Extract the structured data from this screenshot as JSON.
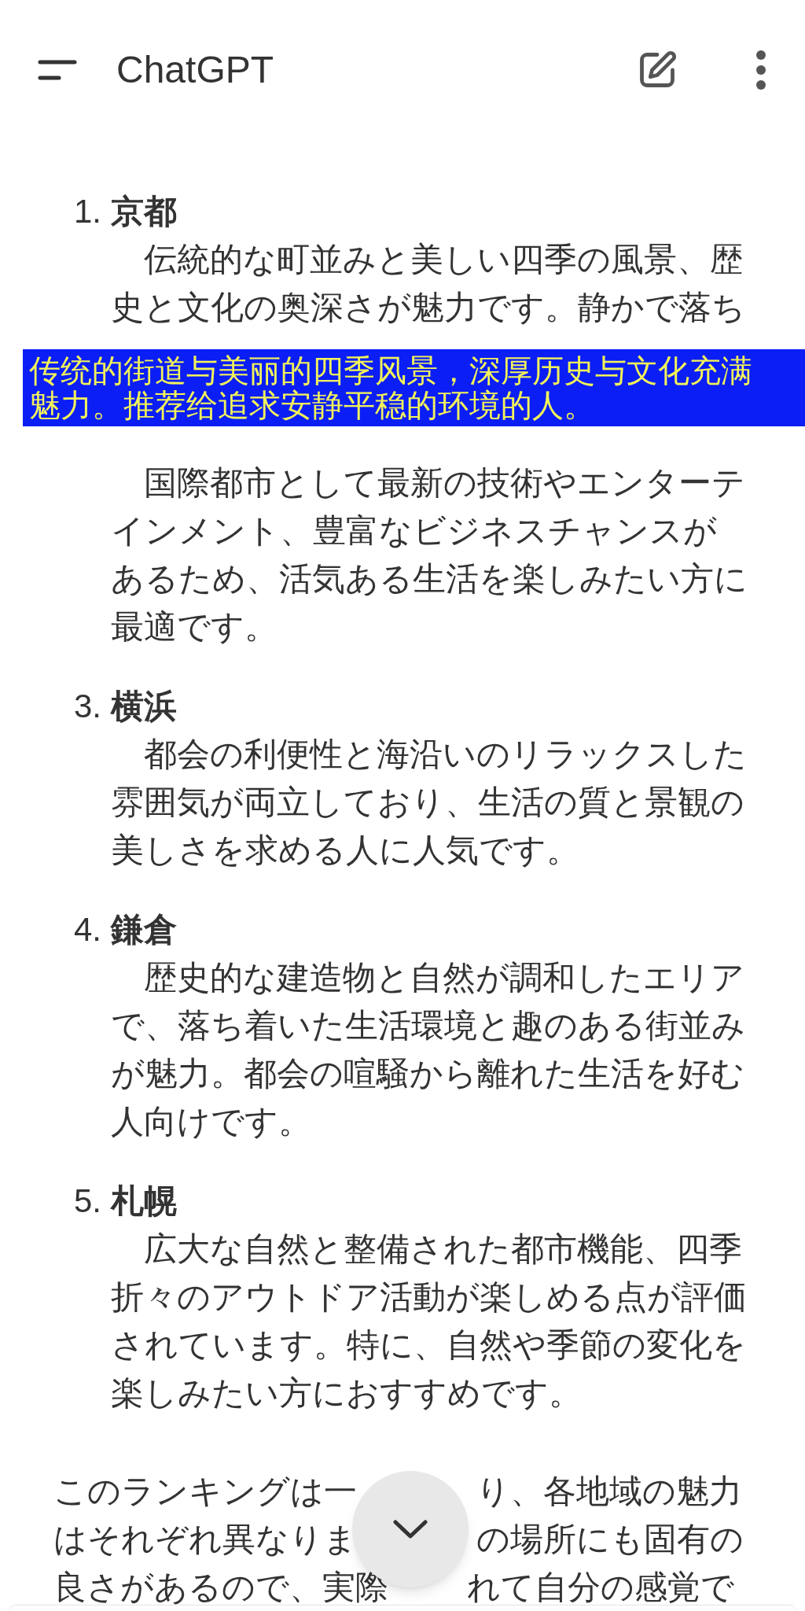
{
  "header": {
    "title": "ChatGPT"
  },
  "items": [
    {
      "number": "1.",
      "title": "京都",
      "description": "伝統的な町並みと美しい四季の風景、歴史と文化の奥深さが魅力です。静かで落ち"
    },
    {
      "description": "国際都市として最新の技術やエンターテインメント、豊富なビジネスチャンスがあるため、活気ある生活を楽しみたい方に最適です。"
    },
    {
      "number": "3.",
      "title": "横浜",
      "description": "都会の利便性と海沿いのリラックスした雰囲気が両立しており、生活の質と景観の美しさを求める人に人気です。"
    },
    {
      "number": "4.",
      "title": "鎌倉",
      "description": "歴史的な建造物と自然が調和したエリアで、落ち着いた生活環境と趣のある街並みが魅力。都会の喧騒から離れた生活を好む人向けです。"
    },
    {
      "number": "5.",
      "title": "札幌",
      "description": "広大な自然と整備された都市機能、四季折々のアウトドア活動が楽しめる点が評価されています。特に、自然や季節の変化を楽しみたい方におすすめです。"
    }
  ],
  "closing_lines": [
    [
      "このランキングは一",
      "り、各地域の魅力"
    ],
    [
      "はそれぞれ異なりま",
      "の場所にも固有の"
    ],
    [
      "良さがあるので、実際",
      "れて自分の感覚で"
    ]
  ],
  "caption_overlay": [
    "传统的街道与美丽的四季风景，深厚历史与文化充满",
    "魅力。推荐给追求安静平稳的环境的人。"
  ]
}
